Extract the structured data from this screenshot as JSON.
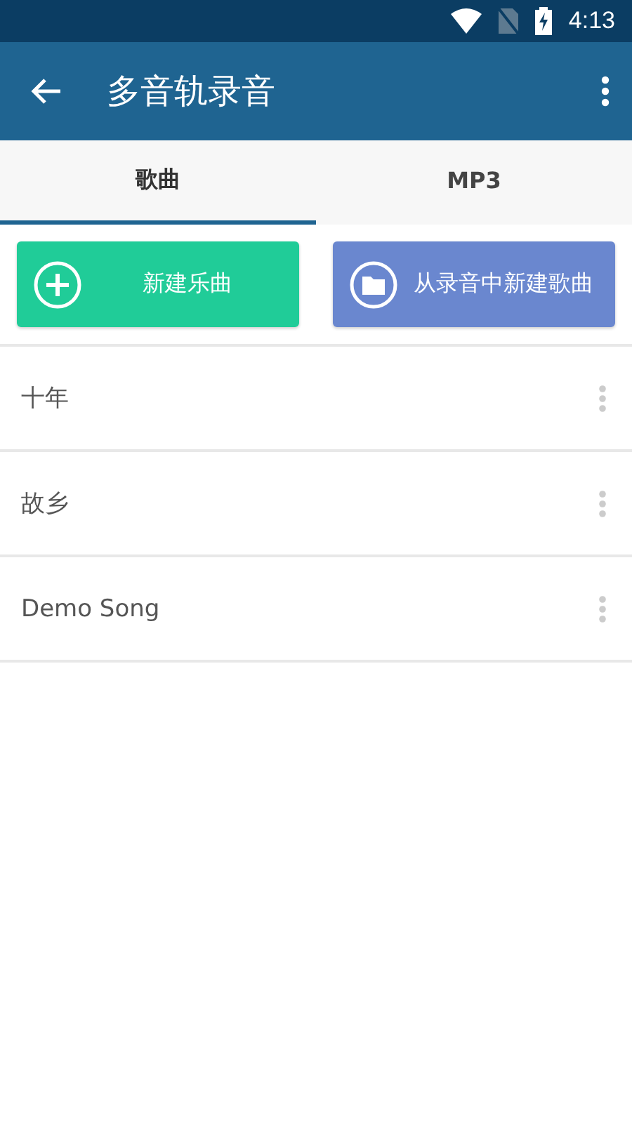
{
  "status_bar": {
    "time": "4:13"
  },
  "app_bar": {
    "title": "多音轨录音"
  },
  "tabs": [
    {
      "label": "歌曲",
      "selected": true
    },
    {
      "label": "MP3",
      "selected": false
    }
  ],
  "actions": [
    {
      "kind": "new",
      "label": "新建乐曲"
    },
    {
      "kind": "import",
      "label": "从录音中新建歌曲"
    }
  ],
  "songs": [
    {
      "title": "十年"
    },
    {
      "title": "故乡"
    },
    {
      "title": "Demo Song"
    }
  ]
}
